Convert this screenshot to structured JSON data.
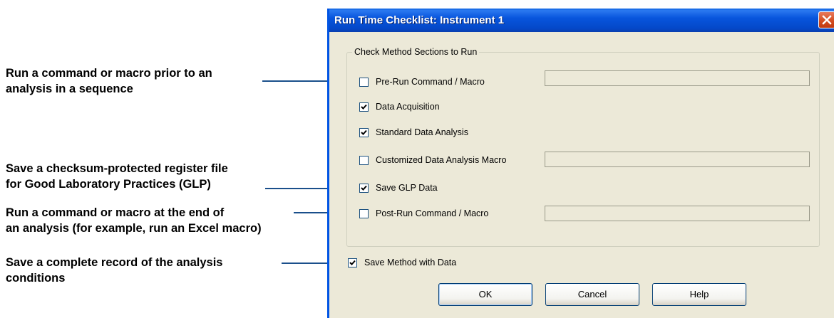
{
  "callouts": [
    {
      "lines": [
        "Run a command or macro prior to an",
        "analysis in a sequence"
      ]
    },
    {
      "lines": [
        "Save a checksum-protected register file",
        "for Good Laboratory Practices (GLP)"
      ]
    },
    {
      "lines": [
        "Run a command or macro at the end of",
        "an analysis (for example, run an Excel macro)"
      ]
    },
    {
      "lines": [
        "Save a complete record of the analysis",
        "conditions"
      ]
    }
  ],
  "dialog": {
    "title": "Run Time Checklist: Instrument 1",
    "group_label": "Check Method Sections to Run",
    "options": [
      {
        "label": "Pre-Run Command / Macro",
        "checked": false,
        "input_value": ""
      },
      {
        "label": "Data Acquisition",
        "checked": true
      },
      {
        "label": "Standard Data Analysis",
        "checked": true
      },
      {
        "label": "Customized Data Analysis Macro",
        "checked": false,
        "input_value": ""
      },
      {
        "label": "Save GLP Data",
        "checked": true
      },
      {
        "label": "Post-Run Command / Macro",
        "checked": false,
        "input_value": ""
      }
    ],
    "save_method": {
      "label": "Save Method with Data",
      "checked": true
    },
    "buttons": {
      "ok": "OK",
      "cancel": "Cancel",
      "help": "Help"
    }
  },
  "colors": {
    "leader_line": "#1a4f8b",
    "titlebar": "#0855dd",
    "dialog_bg": "#ece9d8",
    "close_button": "#d24a1e"
  }
}
